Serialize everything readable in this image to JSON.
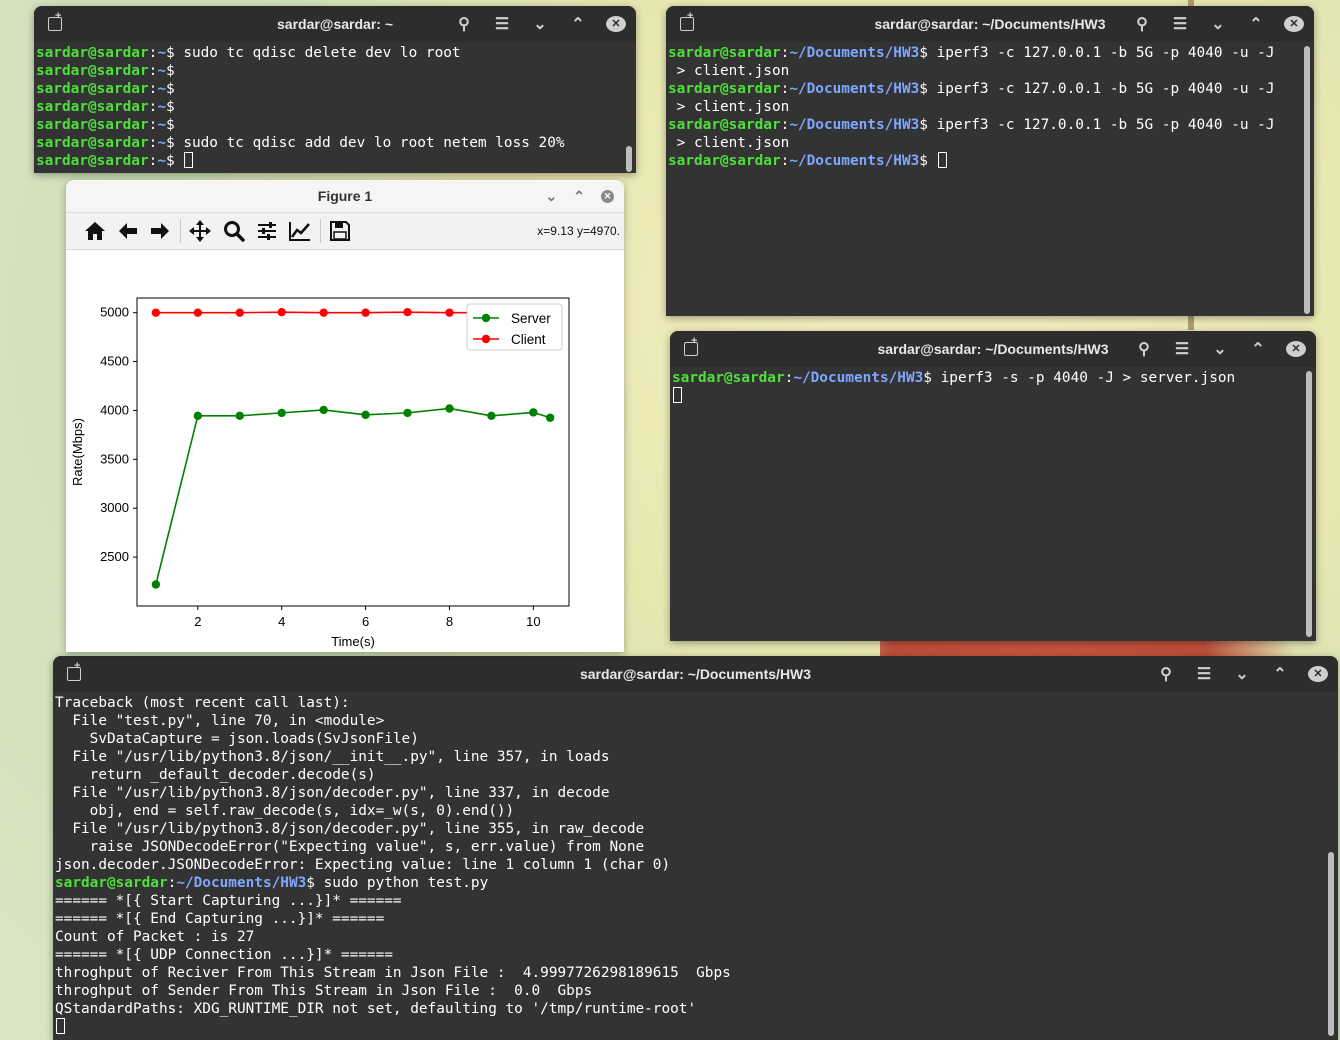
{
  "colors": {
    "terminal_bg": "#323232",
    "prompt_user": "#4ee03a",
    "prompt_path": "#7fa7ff",
    "server_series": "#008000",
    "client_series": "#ff0000"
  },
  "term1": {
    "title": "sardar@sardar: ~",
    "lines": [
      {
        "user": "sardar@sardar",
        "path": "~",
        "cmd": " sudo tc qdisc delete dev lo root"
      },
      {
        "user": "sardar@sardar",
        "path": "~",
        "cmd": ""
      },
      {
        "user": "sardar@sardar",
        "path": "~",
        "cmd": ""
      },
      {
        "user": "sardar@sardar",
        "path": "~",
        "cmd": ""
      },
      {
        "user": "sardar@sardar",
        "path": "~",
        "cmd": ""
      },
      {
        "user": "sardar@sardar",
        "path": "~",
        "cmd": " sudo tc qdisc add dev lo root netem loss 20%"
      },
      {
        "user": "sardar@sardar",
        "path": "~",
        "cmd": " "
      }
    ]
  },
  "term2": {
    "title": "sardar@sardar: ~/Documents/HW3",
    "lines": [
      {
        "user": "sardar@sardar",
        "path": "~/Documents/HW3",
        "cmd": " iperf3 -c 127.0.0.1 -b 5G -p 4040 -u -J"
      },
      {
        "text": " > client.json"
      },
      {
        "user": "sardar@sardar",
        "path": "~/Documents/HW3",
        "cmd": " iperf3 -c 127.0.0.1 -b 5G -p 4040 -u -J"
      },
      {
        "text": " > client.json"
      },
      {
        "user": "sardar@sardar",
        "path": "~/Documents/HW3",
        "cmd": " iperf3 -c 127.0.0.1 -b 5G -p 4040 -u -J"
      },
      {
        "text": " > client.json"
      },
      {
        "user": "sardar@sardar",
        "path": "~/Documents/HW3",
        "cmd": " "
      }
    ]
  },
  "term3": {
    "title": "sardar@sardar: ~/Documents/HW3",
    "lines": [
      {
        "user": "sardar@sardar",
        "path": "~/Documents/HW3",
        "cmd": " iperf3 -s -p 4040 -J > server.json"
      }
    ]
  },
  "term4": {
    "title": "sardar@sardar: ~/Documents/HW3",
    "lines": [
      {
        "text": "Traceback (most recent call last):"
      },
      {
        "text": "  File \"test.py\", line 70, in <module>"
      },
      {
        "text": "    SvDataCapture = json.loads(SvJsonFile)"
      },
      {
        "text": "  File \"/usr/lib/python3.8/json/__init__.py\", line 357, in loads"
      },
      {
        "text": "    return _default_decoder.decode(s)"
      },
      {
        "text": "  File \"/usr/lib/python3.8/json/decoder.py\", line 337, in decode"
      },
      {
        "text": "    obj, end = self.raw_decode(s, idx=_w(s, 0).end())"
      },
      {
        "text": "  File \"/usr/lib/python3.8/json/decoder.py\", line 355, in raw_decode"
      },
      {
        "text": "    raise JSONDecodeError(\"Expecting value\", s, err.value) from None"
      },
      {
        "text": "json.decoder.JSONDecodeError: Expecting value: line 1 column 1 (char 0)"
      },
      {
        "user": "sardar@sardar",
        "path": "~/Documents/HW3",
        "cmd": " sudo python test.py"
      },
      {
        "text": "====== *[{ Start Capturing ...}]* ======"
      },
      {
        "text": "====== *[{ End Capturing ...}]* ======"
      },
      {
        "text": "Count of Packet : is 27"
      },
      {
        "text": "====== *[{ UDP Connection ...}]* ======"
      },
      {
        "text": "throghput of Reciver From This Stream in Json File :  4.9997726298189615  Gbps"
      },
      {
        "text": "throghput of Sender From This Stream in Json File :  0.0  Gbps"
      },
      {
        "text": "QStandardPaths: XDG_RUNTIME_DIR not set, defaulting to '/tmp/runtime-root'"
      }
    ]
  },
  "figure": {
    "title": "Figure 1",
    "coords": "x=9.13 y=4970.",
    "toolbar_icons": [
      "home-icon",
      "back-arrow-icon",
      "forward-arrow-icon",
      "pan-icon",
      "zoom-icon",
      "configure-subplots-icon",
      "edit-axis-icon",
      "save-icon"
    ]
  },
  "chart_data": {
    "type": "line",
    "xlabel": "Time(s)",
    "ylabel": "Rate(Mbps)",
    "xlim": [
      0.55,
      10.85
    ],
    "ylim": [
      2000,
      5150
    ],
    "xticks": [
      2,
      4,
      6,
      8,
      10
    ],
    "yticks": [
      2500,
      3000,
      3500,
      4000,
      4500,
      5000
    ],
    "legend_position": "top-right",
    "series": [
      {
        "name": "Server",
        "color": "#008000",
        "x": [
          1,
          2,
          3,
          4,
          5,
          6,
          7,
          8,
          9,
          10,
          10.4
        ],
        "y": [
          2220,
          3945,
          3945,
          3975,
          4005,
          3955,
          3975,
          4020,
          3945,
          3980,
          3925
        ]
      },
      {
        "name": "Client",
        "color": "#ff0000",
        "x": [
          1,
          2,
          3,
          4,
          5,
          6,
          7,
          8,
          9,
          10,
          10.4
        ],
        "y": [
          5000,
          5000,
          5000,
          5005,
          5000,
          5000,
          5005,
          5000,
          5000,
          5000,
          5000
        ]
      }
    ]
  }
}
